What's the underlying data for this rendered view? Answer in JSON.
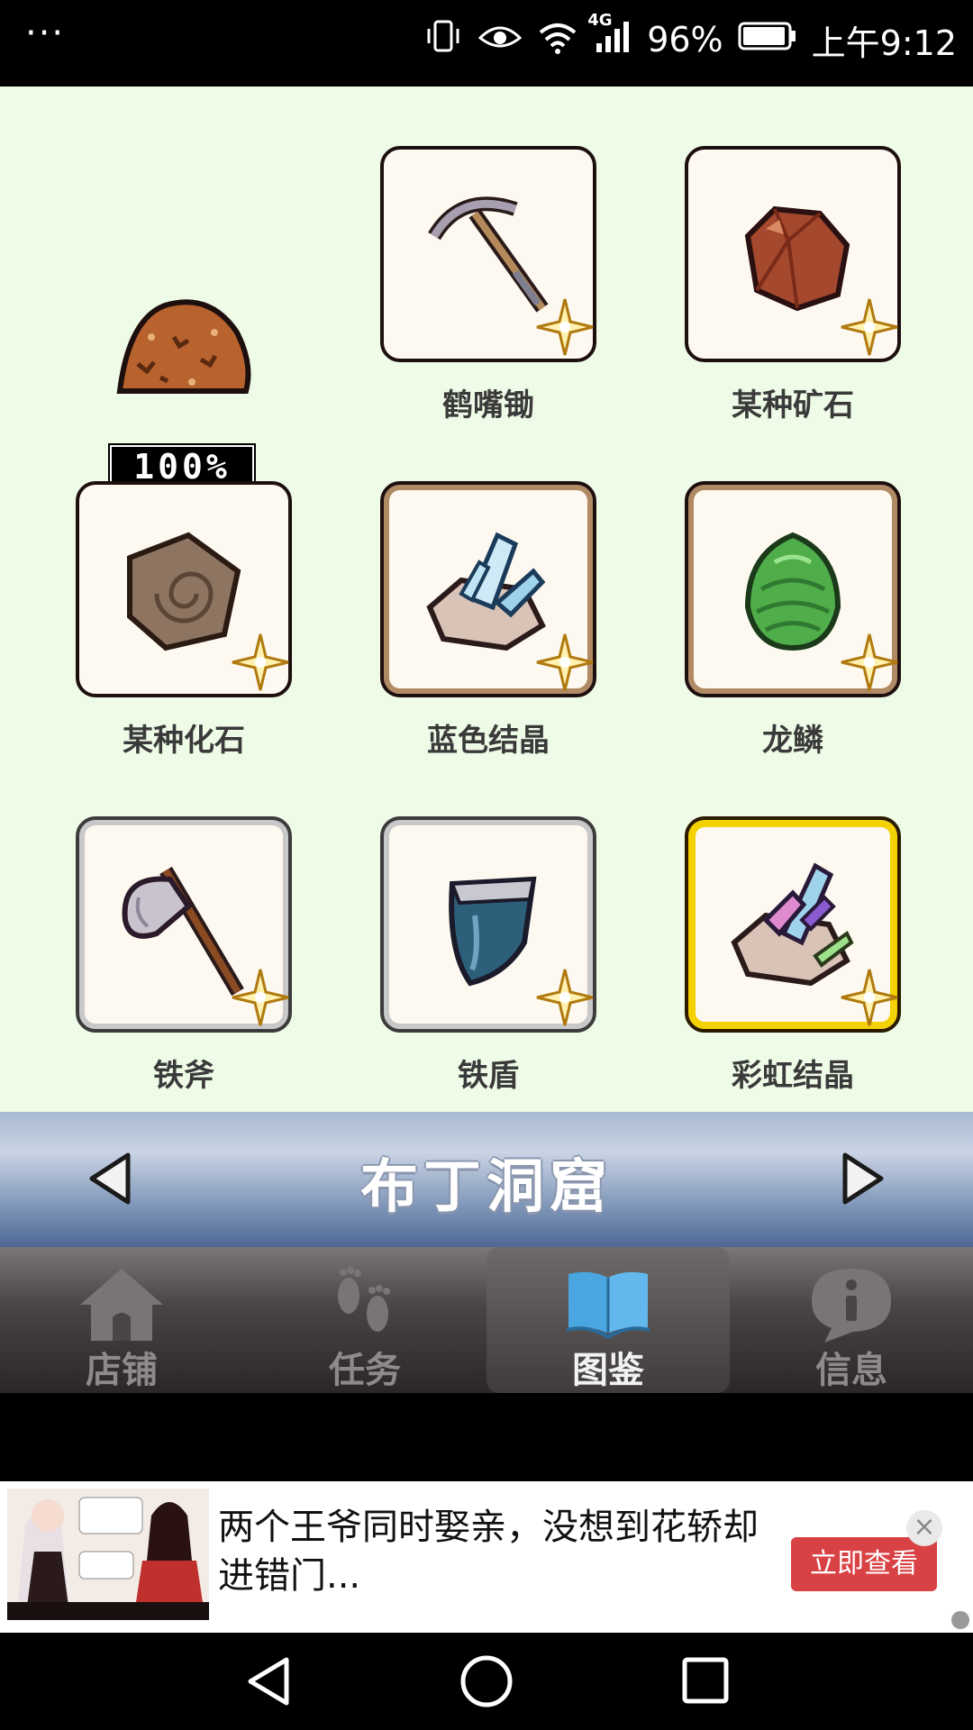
{
  "status_bar": {
    "menu_dots": "···",
    "network": "4G",
    "battery": "96%",
    "time": "上午9:12"
  },
  "collection": {
    "summary": {
      "icon": "ore-pile-icon",
      "percent": "100%"
    },
    "items": [
      {
        "label": "鹤嘴锄",
        "icon": "pickaxe-icon",
        "frame": "plain"
      },
      {
        "label": "某种矿石",
        "icon": "ore-icon",
        "frame": "plain"
      },
      {
        "label": "某种化石",
        "icon": "fossil-icon",
        "frame": "plain"
      },
      {
        "label": "蓝色结晶",
        "icon": "blue-crystal-icon",
        "frame": "bronze"
      },
      {
        "label": "龙鳞",
        "icon": "dragon-scale-icon",
        "frame": "bronze"
      },
      {
        "label": "铁斧",
        "icon": "iron-axe-icon",
        "frame": "silver"
      },
      {
        "label": "铁盾",
        "icon": "iron-shield-icon",
        "frame": "silver"
      },
      {
        "label": "彩虹结晶",
        "icon": "rainbow-crystal-icon",
        "frame": "gold"
      }
    ]
  },
  "location": {
    "title": "布丁洞窟"
  },
  "tabs": [
    {
      "label": "店铺",
      "icon": "shop-icon",
      "active": false
    },
    {
      "label": "任务",
      "icon": "footprints-icon",
      "active": false
    },
    {
      "label": "图鉴",
      "icon": "book-icon",
      "active": true
    },
    {
      "label": "信息",
      "icon": "info-icon",
      "active": false
    }
  ],
  "ad": {
    "text": "两个王爷同时娶亲，没想到花轿却进错门...",
    "cta": "立即查看",
    "close": "×"
  },
  "colors": {
    "collection_bg": "#eefbe6",
    "gold_frame": "#f4d100",
    "bronze_frame": "#b08a64",
    "silver_frame": "#c8c8c8",
    "ad_button": "#d94245"
  }
}
